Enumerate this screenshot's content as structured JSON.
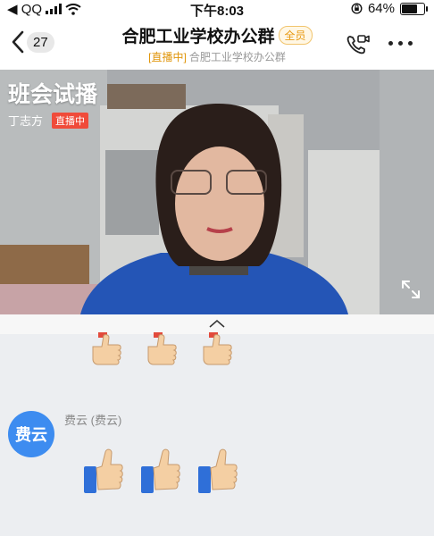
{
  "status_bar": {
    "carrier": "◀ QQ",
    "time": "下午8:03",
    "battery_percent": "64%",
    "battery_level": 0.64
  },
  "nav": {
    "back_count": "27",
    "title": "合肥工业学校办公群",
    "badge": "全员",
    "subtitle_live": "[直播中]",
    "subtitle_name": "合肥工业学校办公群"
  },
  "video": {
    "title": "班会试播",
    "host": "丁志方",
    "live_tag": "直播中"
  },
  "chat": {
    "message": {
      "avatar_text": "费云",
      "sender": "费云 (费云)",
      "emojis": [
        "thumbs-up",
        "thumbs-up",
        "thumbs-up"
      ]
    },
    "prev_message_emojis": [
      "thumbs-up",
      "thumbs-up",
      "thumbs-up"
    ]
  },
  "colors": {
    "accent_blue": "#3d8cf0",
    "live_red": "#f04b3a",
    "badge_orange": "#e89a13"
  }
}
